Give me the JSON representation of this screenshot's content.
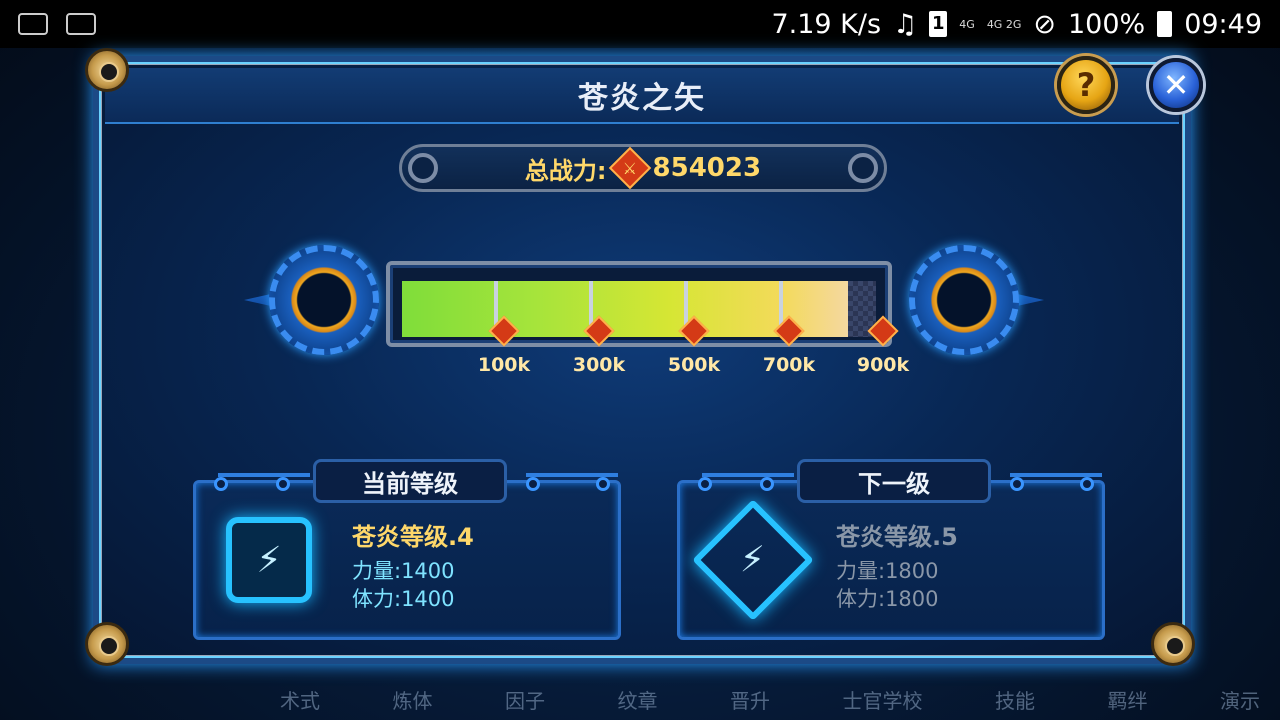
{
  "status_bar": {
    "net_speed": "7.19 K/s",
    "sim_slot": "1",
    "network_4g": "4G",
    "network_4g_2g": "4G 2G",
    "battery": "100%",
    "time": "09:49",
    "icons": [
      "chat-icon",
      "image-icon",
      "mute-icon",
      "signal-icon",
      "no-disturb-icon",
      "battery-icon"
    ]
  },
  "background_nav": [
    "术式",
    "炼体",
    "因子",
    "纹章",
    "晋升",
    "士官学校",
    "技能",
    "羁绊",
    "演示"
  ],
  "dialog": {
    "title": "苍炎之矢",
    "help_label": "?",
    "close_label": "✕"
  },
  "total_power": {
    "label": "总战力:",
    "value": "854023"
  },
  "progress": {
    "value": 854023,
    "max": 900000,
    "fraction": 0.94,
    "milestones": [
      "100k",
      "300k",
      "500k",
      "700k",
      "900k"
    ],
    "colors": {
      "start": "#7fdd3a",
      "end": "#f4d8a0"
    }
  },
  "current_level": {
    "tab_label": "当前等级",
    "name": "苍炎等级.4",
    "stat_strength": "力量:1400",
    "stat_stamina": "体力:1400"
  },
  "next_level": {
    "tab_label": "下一级",
    "name": "苍炎等级.5",
    "stat_strength": "力量:1800",
    "stat_stamina": "体力:1800"
  },
  "colors": {
    "accent_gold": "#ffd86a",
    "accent_cyan": "#7fe3ff",
    "disabled": "#8a97a8"
  }
}
